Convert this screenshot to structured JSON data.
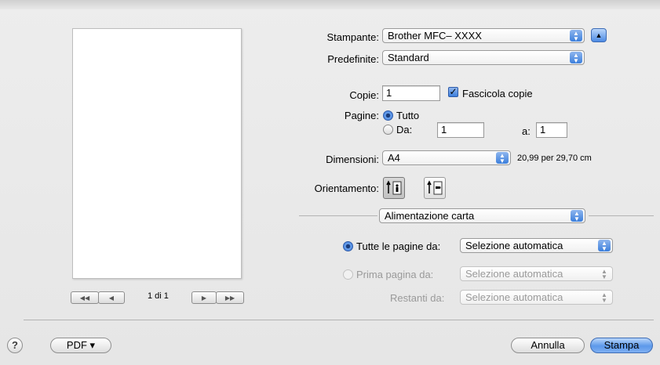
{
  "printer": {
    "label": "Stampante:",
    "value": "Brother MFC–  XXXX"
  },
  "presets": {
    "label": "Predefinite:",
    "value": "Standard"
  },
  "copies": {
    "label": "Copie:",
    "value": "1",
    "collate_label": "Fascicola copie",
    "collate_checked": true
  },
  "pages": {
    "label": "Pagine:",
    "all_label": "Tutto",
    "from_label": "Da:",
    "from_value": "1",
    "to_label": "a:",
    "to_value": "1",
    "selected": "all"
  },
  "paper_size": {
    "label": "Dimensioni:",
    "value": "A4",
    "dims": "20,99 per 29,70 cm"
  },
  "orientation": {
    "label": "Orientamento:",
    "selected": "portrait"
  },
  "section": {
    "value": "Alimentazione carta"
  },
  "feed": {
    "all_pages_label": "Tutte le pagine da:",
    "all_pages_value": "Selezione automatica",
    "first_page_label": "Prima pagina da:",
    "first_page_value": "Selezione automatica",
    "remaining_label": "Restanti da:",
    "remaining_value": "Selezione automatica",
    "selected": "all"
  },
  "preview": {
    "page_text": "1 di 1"
  },
  "footer": {
    "help": "?",
    "pdf_label": "PDF ▾",
    "cancel_label": "Annulla",
    "print_label": "Stampa"
  },
  "icons": [
    "up-arrow-icon",
    "popup-arrows-icon",
    "checkmark-icon",
    "portrait-icon",
    "landscape-icon",
    "first-page-icon",
    "prev-page-icon",
    "next-page-icon",
    "last-page-icon"
  ]
}
